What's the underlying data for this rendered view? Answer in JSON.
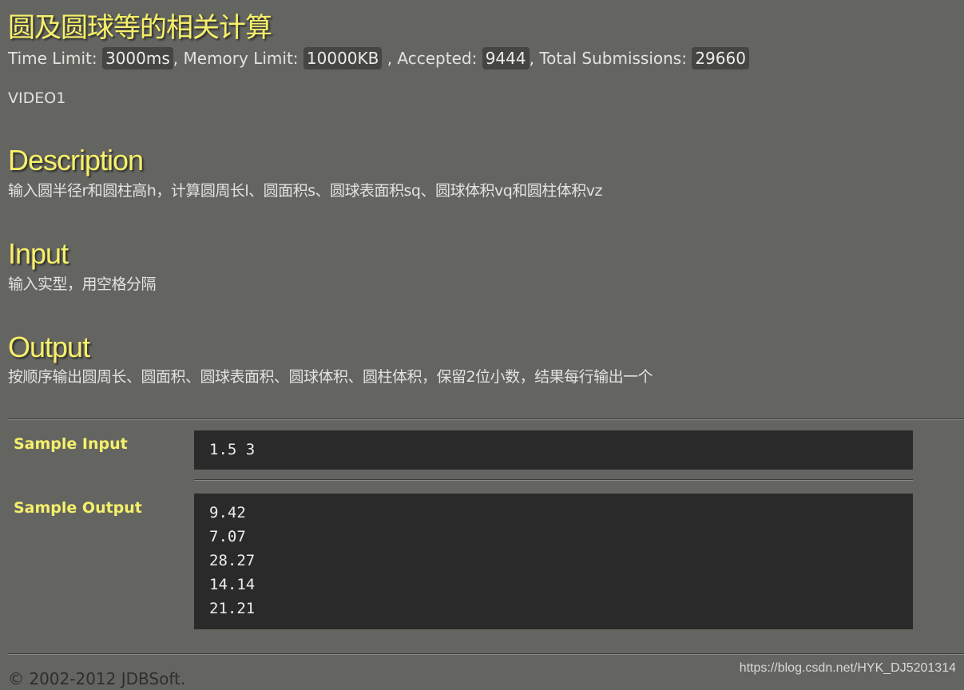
{
  "problem": {
    "title": "圆及圆球等的相关计算",
    "limits": {
      "time_label": "Time Limit:",
      "time_value": "3000ms",
      "memory_sep": ", Memory Limit:",
      "memory_value": "10000KB",
      "accepted_sep": ", Accepted:",
      "accepted_value": "9444",
      "total_sep": ", Total Submissions:",
      "total_value": "29660"
    },
    "source": "VIDEO1"
  },
  "sections": {
    "description": {
      "heading": "Description",
      "text": "输入圆半径r和圆柱高h，计算圆周长l、圆面积s、圆球表面积sq、圆球体积vq和圆柱体积vz"
    },
    "input": {
      "heading": "Input",
      "text": "输入实型，用空格分隔"
    },
    "output": {
      "heading": "Output",
      "text": "按顺序输出圆周长、圆面积、圆球表面积、圆球体积、圆柱体积，保留2位小数，结果每行输出一个"
    }
  },
  "samples": {
    "input_label": "Sample Input",
    "input_lines": [
      "1.5 3"
    ],
    "output_label": "Sample Output",
    "output_lines": [
      "9.42",
      "7.07",
      "28.27",
      "14.14",
      "21.21"
    ]
  },
  "footer": {
    "copyright": "© 2002-2012  JDBSoft.",
    "watermark": "https://blog.csdn.net/HYK_DJ5201314"
  }
}
